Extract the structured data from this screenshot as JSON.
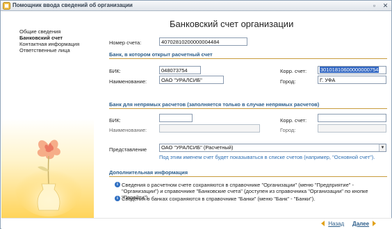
{
  "window": {
    "title": "Помощник ввода сведений об организации",
    "minimize_icon": "minimize-icon",
    "close_icon": "close-icon"
  },
  "sidebar": {
    "items": [
      {
        "label": "Общие сведения",
        "active": false
      },
      {
        "label": "Банковский счет",
        "active": true
      },
      {
        "label": "Контактная информация",
        "active": false
      },
      {
        "label": "Ответственные лица",
        "active": false
      }
    ]
  },
  "main": {
    "heading": "Банковский счет организации",
    "account": {
      "label": "Номер счета:",
      "value": "40702810200000004484"
    },
    "bank_section": {
      "title": "Банк, в котором открыт расчетный счет",
      "bik_label": "БИК:",
      "bik_value": "048073754",
      "corr_label": "Корр. счет:",
      "corr_value": "30101810600000000754",
      "name_label": "Наименование:",
      "name_value": "ОАО \"УРАЛСИБ\"",
      "city_label": "Город:",
      "city_value": "Г. УФА"
    },
    "indirect_section": {
      "title": "Банк для непрямых расчетов (заполняется только в случае непрямых расчетов)",
      "bik_label": "БИК:",
      "bik_value": "",
      "corr_label": "Корр. счет:",
      "corr_value": "",
      "name_label": "Наименование:",
      "name_value": "",
      "city_label": "Город:",
      "city_value": ""
    },
    "representation": {
      "label": "Представление",
      "value": "ОАО \"УРАЛСИБ\" (Расчетный)",
      "hint": "Под этим именем счет будет показываться в списке счетов (например, \"Основной счет\")."
    },
    "extra_section": {
      "title": "Дополнительная информация",
      "info1": "Сведения о расчетном счете сохраняются в справочнике \"Организации\" (меню \"Предприятие\" - \"Организации\") и справочнике \"Банковские счета\" (доступен из справочника \"Организации\" по кнопке \"Перейти\").",
      "info2": "Сведения о банках сохраняются в справочнике \"Банки\" (меню \"Банк\" - \"Банки\")."
    }
  },
  "footer": {
    "back_label": "Назад",
    "next_label": "Далее"
  },
  "colors": {
    "section_title": "#2b5d8a",
    "section_line": "#c89b3c",
    "hint": "#2d6fb3",
    "selection": "#3166c2"
  }
}
